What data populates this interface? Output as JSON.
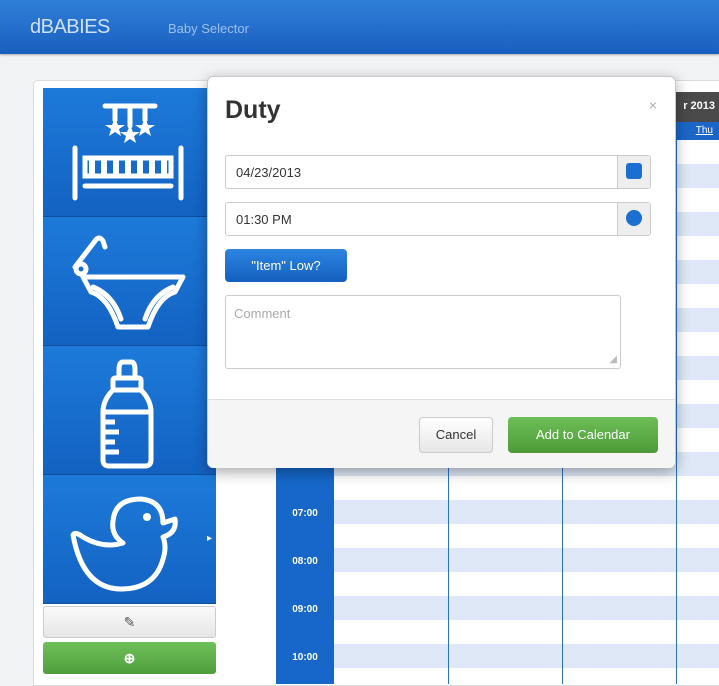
{
  "nav": {
    "brand": "dBABIES",
    "link": "Baby Selector"
  },
  "sidebar": {
    "tiles": [
      {
        "icon": "crib-icon"
      },
      {
        "icon": "diaper-icon"
      },
      {
        "icon": "bottle-icon"
      },
      {
        "icon": "duck-icon"
      }
    ],
    "tool_icon": "wrench-icon",
    "add_icon": "plus-circle-icon"
  },
  "calendar": {
    "header": "r 2013",
    "day": "Thu",
    "times": [
      "07:00",
      "08:00",
      "09:00",
      "10:00"
    ]
  },
  "modal": {
    "title": "Duty",
    "close": "×",
    "date_value": "04/23/2013",
    "time_value": "01:30 PM",
    "item_low_label": "\"Item\" Low?",
    "comment_placeholder": "Comment",
    "cancel_label": "Cancel",
    "add_label": "Add to Calendar"
  },
  "colors": {
    "accent": "#1a6fd0",
    "success": "#5aa845",
    "navbar": "#1f68c8"
  }
}
